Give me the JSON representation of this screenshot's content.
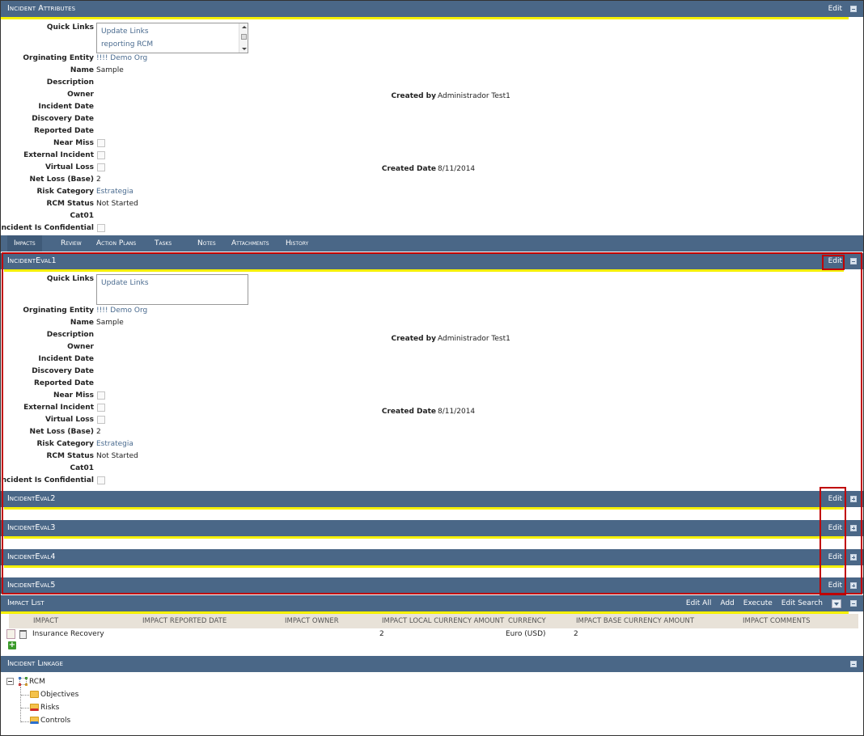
{
  "incident_attributes": {
    "title": "Incident Attributes",
    "edit_label": "Edit",
    "quick_links_label": "Quick Links",
    "quick_links": [
      "Update Links",
      "reporting RCM"
    ],
    "fields": {
      "originating_entity": {
        "label": "Orginating Entity",
        "value": "!!!! Demo Org"
      },
      "name": {
        "label": "Name",
        "value": "Sample"
      },
      "description": {
        "label": "Description",
        "value": ""
      },
      "owner": {
        "label": "Owner",
        "value": ""
      },
      "incident_date": {
        "label": "Incident Date",
        "value": ""
      },
      "discovery_date": {
        "label": "Discovery Date",
        "value": ""
      },
      "reported_date": {
        "label": "Reported Date",
        "value": ""
      },
      "near_miss": {
        "label": "Near Miss",
        "checked": false
      },
      "external_incident": {
        "label": "External Incident",
        "checked": false
      },
      "virtual_loss": {
        "label": "Virtual Loss",
        "checked": false
      },
      "net_loss": {
        "label": "Net Loss (Base)",
        "value": "2"
      },
      "risk_category": {
        "label": "Risk Category",
        "value": "Estrategia"
      },
      "rcm_status": {
        "label": "RCM Status",
        "value": "Not Started"
      },
      "cat01": {
        "label": "Cat01",
        "value": ""
      },
      "confidential": {
        "label": "Incident Is Confidential",
        "checked": false
      }
    },
    "created_by": {
      "label": "Created by",
      "value": "Administrador Test1"
    },
    "created_date": {
      "label": "Created Date",
      "value": "8/11/2014"
    }
  },
  "tabs": [
    "Impacts",
    "Review",
    "Action Plans",
    "Tasks",
    "Notes",
    "Attachments",
    "History"
  ],
  "active_tab": "Impacts",
  "eval1": {
    "title": "IncidentEval1",
    "edit_label": "Edit",
    "quick_links_label": "Quick Links",
    "quick_links": [
      "Update Links"
    ],
    "fields": {
      "originating_entity": {
        "label": "Orginating Entity",
        "value": "!!!! Demo Org"
      },
      "name": {
        "label": "Name",
        "value": "Sample"
      },
      "description": {
        "label": "Description",
        "value": ""
      },
      "owner": {
        "label": "Owner",
        "value": ""
      },
      "incident_date": {
        "label": "Incident Date",
        "value": ""
      },
      "discovery_date": {
        "label": "Discovery Date",
        "value": ""
      },
      "reported_date": {
        "label": "Reported Date",
        "value": ""
      },
      "near_miss": {
        "label": "Near Miss",
        "checked": false
      },
      "external_incident": {
        "label": "External Incident",
        "checked": false
      },
      "virtual_loss": {
        "label": "Virtual Loss",
        "checked": false
      },
      "net_loss": {
        "label": "Net Loss (Base)",
        "value": "2"
      },
      "risk_category": {
        "label": "Risk Category",
        "value": "Estrategia"
      },
      "rcm_status": {
        "label": "RCM Status",
        "value": "Not Started"
      },
      "cat01": {
        "label": "Cat01",
        "value": ""
      },
      "confidential": {
        "label": "Incident Is Confidential",
        "checked": false
      }
    },
    "created_by": {
      "label": "Created by",
      "value": "Administrador Test1"
    },
    "created_date": {
      "label": "Created Date",
      "value": "8/11/2014"
    }
  },
  "collapsed_evals": [
    {
      "title": "IncidentEval2",
      "edit_label": "Edit"
    },
    {
      "title": "IncidentEval3",
      "edit_label": "Edit"
    },
    {
      "title": "IncidentEval4",
      "edit_label": "Edit"
    },
    {
      "title": "IncidentEval5",
      "edit_label": "Edit"
    }
  ],
  "impact_list": {
    "title": "Impact List",
    "actions": [
      "Edit All",
      "Add",
      "Execute",
      "Edit Search"
    ],
    "columns": [
      "IMPACT",
      "IMPACT REPORTED DATE",
      "IMPACT OWNER",
      "IMPACT LOCAL CURRENCY AMOUNT",
      "CURRENCY",
      "IMPACT BASE CURRENCY AMOUNT",
      "IMPACT COMMENTS"
    ],
    "rows": [
      {
        "impact": "Insurance Recovery",
        "reported_date": "",
        "owner": "",
        "local_amount": "2",
        "currency": "Euro (USD)",
        "base_amount": "2",
        "comments": ""
      }
    ]
  },
  "incident_linkage": {
    "title": "Incident Linkage",
    "root": "RCM",
    "children": [
      "Objectives",
      "Risks",
      "Controls"
    ]
  }
}
